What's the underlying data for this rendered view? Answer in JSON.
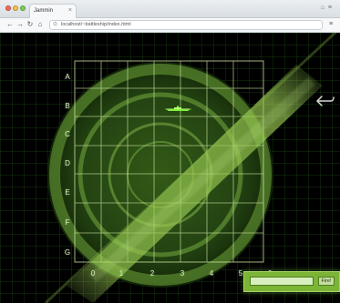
{
  "browser": {
    "tab_title": "Jammin",
    "tab_close": "×",
    "address": "localhost/~battleship/index.html",
    "window_controls": "⌂ ≡",
    "back": "←",
    "forward": "→",
    "refresh": "↻",
    "home": "⌂",
    "menu": "≡"
  },
  "radar": {
    "row_labels": [
      "A",
      "B",
      "C",
      "D",
      "E",
      "F",
      "G"
    ],
    "col_labels": [
      "0",
      "1",
      "2",
      "3",
      "4",
      "5",
      "6"
    ]
  },
  "controls": {
    "fire_input_value": "",
    "fire_input_placeholder": "",
    "fire_button_label": "Fire!"
  },
  "colors": {
    "background": "#000000",
    "grid": "#c9e29a",
    "radar_dark": "#23410c",
    "radar_ring": "#6fa63a",
    "sweep": "#8ebd47",
    "panel": "#7cb536",
    "ship": "#82ef38"
  },
  "icons": {
    "back_arrow": "back-arrow-icon",
    "ship": "ship-icon"
  }
}
